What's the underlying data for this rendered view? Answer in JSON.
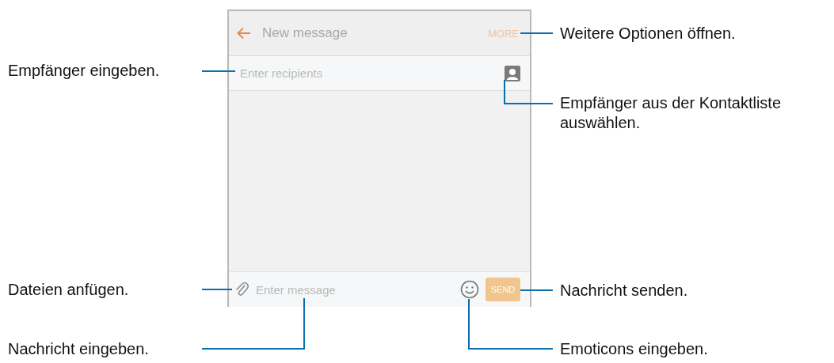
{
  "phone": {
    "title": "New message",
    "menu": "MORE",
    "recipients_placeholder": "Enter recipients",
    "message_placeholder": "Enter message",
    "send": "SEND"
  },
  "callouts": [
    {
      "text": "Weitere Optionen öffnen."
    },
    {
      "text": "Empfänger eingeben."
    },
    {
      "text": "Empfänger aus der Kontaktliste auswählen."
    },
    {
      "text": "Dateien anfügen."
    },
    {
      "text": "Nachricht senden."
    },
    {
      "text": "Nachricht eingeben."
    },
    {
      "text": "Emoticons eingeben."
    }
  ]
}
